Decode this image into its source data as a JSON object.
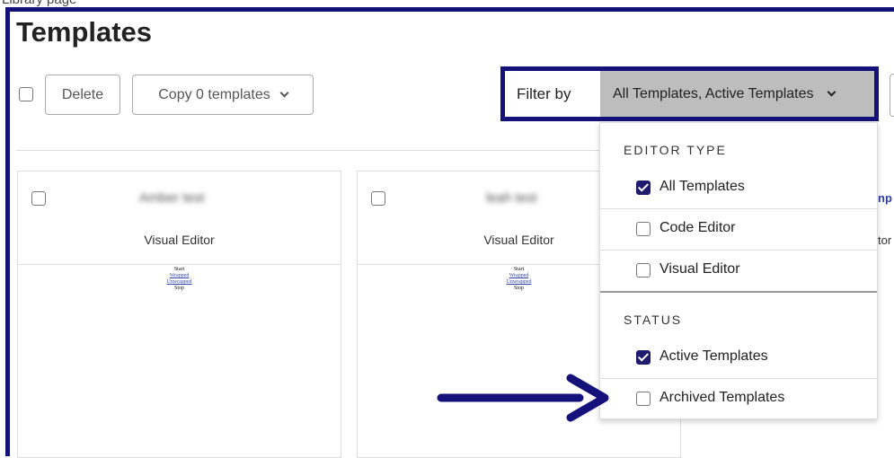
{
  "caption": "Library page",
  "page": {
    "title": "Templates"
  },
  "toolbar": {
    "delete_label": "Delete",
    "copy_label": "Copy 0 templates"
  },
  "filter": {
    "label": "Filter by",
    "selected_value": "All Templates, Active Templates"
  },
  "dropdown": {
    "sections": [
      {
        "title": "EDITOR TYPE",
        "options": [
          {
            "label": "All Templates",
            "checked": true
          },
          {
            "label": "Code Editor",
            "checked": false
          },
          {
            "label": "Visual Editor",
            "checked": false
          }
        ]
      },
      {
        "title": "STATUS",
        "options": [
          {
            "label": "Active Templates",
            "checked": true
          },
          {
            "label": "Archived Templates",
            "checked": false
          }
        ]
      }
    ]
  },
  "cards": [
    {
      "name": "Amber test",
      "editor": "Visual Editor",
      "preview": [
        "Start",
        "Wrapped",
        "Unwrapped",
        "Stop"
      ]
    },
    {
      "name": "leah test",
      "editor": "Visual Editor",
      "preview": [
        "Start",
        "Wrapped",
        "Unwrapped",
        "Stop"
      ]
    }
  ],
  "partial_text": {
    "card3_name": "np",
    "card3_editor": "tor"
  },
  "annotations": {
    "highlight_color": "#14117a",
    "arrow_target": "Archived Templates"
  },
  "colors": {
    "accent": "#14117a",
    "checkbox_checked": "#1f1a6e",
    "select_bg": "#bdbdbd"
  }
}
